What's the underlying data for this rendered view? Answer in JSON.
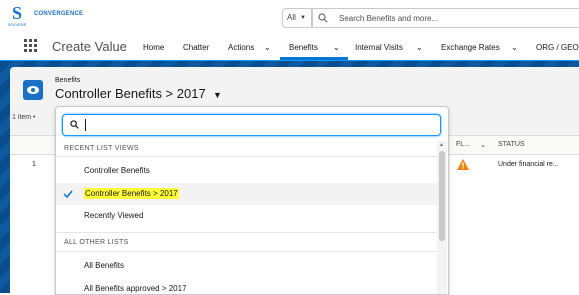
{
  "header": {
    "brand": "CONVERGENCE",
    "logo_letter": "S",
    "logo_sub": "SOLVERE",
    "search_scope": "All",
    "search_placeholder": "Search Benefits and more..."
  },
  "nav": {
    "app_name": "Create Value",
    "items": [
      {
        "label": "Home"
      },
      {
        "label": "Chatter"
      },
      {
        "label": "Actions"
      },
      {
        "label": "Benefits"
      },
      {
        "label": "Internal Visits"
      },
      {
        "label": "Exchange Rates"
      },
      {
        "label": "ORG / GEO"
      }
    ],
    "active_index": 3
  },
  "list_header": {
    "object_label": "Benefits",
    "list_view_title": "Controller Benefits > 2017",
    "item_count": "1 item •"
  },
  "table": {
    "columns": [
      {
        "label": "FL..."
      },
      {
        "label": "STATUS"
      }
    ],
    "rows": [
      {
        "row_number": "1",
        "status": "Under financial re..."
      }
    ]
  },
  "dropdown": {
    "search_value": "",
    "sections": [
      {
        "title": "RECENT LIST VIEWS",
        "items": [
          {
            "label": "Controller Benefits",
            "selected": false
          },
          {
            "label": "Controller Benefits > 2017",
            "selected": true
          },
          {
            "label": "Recently Viewed",
            "selected": false
          }
        ]
      },
      {
        "title": "ALL OTHER LISTS",
        "items": [
          {
            "label": "All Benefits",
            "selected": false
          },
          {
            "label": "All Benefits approved > 2017",
            "selected": false
          }
        ]
      }
    ]
  },
  "colors": {
    "brand_blue": "#1b6fc4",
    "active_nav": "#0176d3",
    "highlight": "#ffff3a",
    "warning": "#f38303"
  },
  "icons": [
    "search-icon",
    "waffle-icon",
    "chevron-down-icon",
    "list-view-icon",
    "warning-icon",
    "check-icon"
  ]
}
